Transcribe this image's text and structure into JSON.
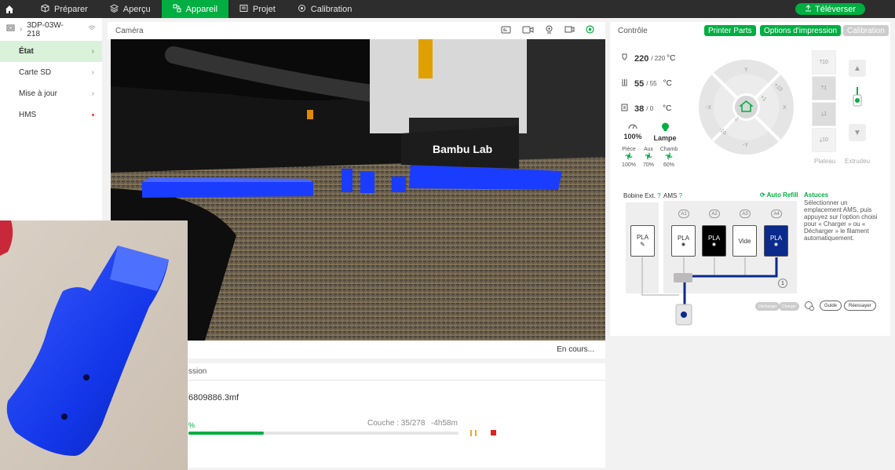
{
  "nav": {
    "tabs": [
      {
        "label": "Préparer",
        "icon": "cube-icon"
      },
      {
        "label": "Aperçu",
        "icon": "layers-icon"
      },
      {
        "label": "Appareil",
        "icon": "device-icon"
      },
      {
        "label": "Projet",
        "icon": "project-icon"
      },
      {
        "label": "Calibration",
        "icon": "calibration-icon"
      }
    ],
    "active_tab": "Appareil",
    "upload_label": "Téléverser"
  },
  "sidebar": {
    "device_name": "3DP-03W-218",
    "items": [
      {
        "label": "État"
      },
      {
        "label": "Carte SD"
      },
      {
        "label": "Mise à jour"
      },
      {
        "label": "HMS"
      }
    ]
  },
  "camera": {
    "title": "Caméra",
    "status": "En cours...",
    "printer_brand": "Bambu Lab"
  },
  "print": {
    "section_title": "ssion",
    "filename": "6809886.3mf",
    "percent_text": "%",
    "layer_text": "Couche : 35/278",
    "remaining_text": "-4h58m",
    "progress": 0.28
  },
  "control": {
    "title": "Contrôle",
    "btn_printer_parts": "Printer Parts",
    "btn_print_options": "Options d'impression",
    "btn_calibration": "Calibration",
    "nozzle": {
      "current": "220",
      "target": "/ 220",
      "unit": "°C"
    },
    "bed": {
      "current": "55",
      "target": "/ 55",
      "unit": "°C"
    },
    "chamber": {
      "current": "38",
      "target": "/ 0",
      "unit": "°C"
    },
    "speed": "100%",
    "lamp": "Lampe",
    "fans": [
      {
        "label": "Pièce",
        "value": "100%"
      },
      {
        "label": "Aux",
        "value": "70%"
      },
      {
        "label": "Chamb",
        "value": "60%"
      }
    ],
    "dpad": {
      "y_plus": "Y",
      "y_minus": "-Y",
      "x_plus": "X",
      "x_minus": "-X",
      "p10": "+10",
      "p1": "+1",
      "m1": "-1",
      "m10": "-10"
    },
    "z_steps": [
      "10",
      "1",
      "1",
      "10"
    ],
    "plateau_label": "Plateau",
    "extruder_label": "Extrudeu"
  },
  "ams": {
    "ext_label": "Bobine Ext.",
    "ams_label": "AMS",
    "auto_refill": "Auto Refill",
    "ext_slot": {
      "label": "PLA"
    },
    "slots": [
      {
        "id": "A1",
        "label": "PLA",
        "bg": "#ffffff",
        "fg": "#333333"
      },
      {
        "id": "A2",
        "label": "PLA",
        "bg": "#000000",
        "fg": "#ffffff"
      },
      {
        "id": "A3",
        "label": "Vide",
        "bg": "#ffffff",
        "fg": "#333333"
      },
      {
        "id": "A4",
        "label": "PLA",
        "bg": "#0a2a8c",
        "fg": "#ffffff"
      }
    ],
    "tips_title": "Astuces",
    "tips_text": "Sélectionner un emplacement AMS, puis appuyez sur l'option choisi pour « Charger » ou « Décharger » le filament automatiquement.",
    "btn_unload": "Décharger",
    "btn_load": "Charger",
    "btn_guide": "Guide",
    "btn_retry": "Réessayer",
    "indicator": "1"
  },
  "colors": {
    "accent": "#00ae42",
    "topbar": "#2d2d2d",
    "stop": "#e02020",
    "pause": "#f5a623",
    "filament_blue": "#1a3cff"
  }
}
